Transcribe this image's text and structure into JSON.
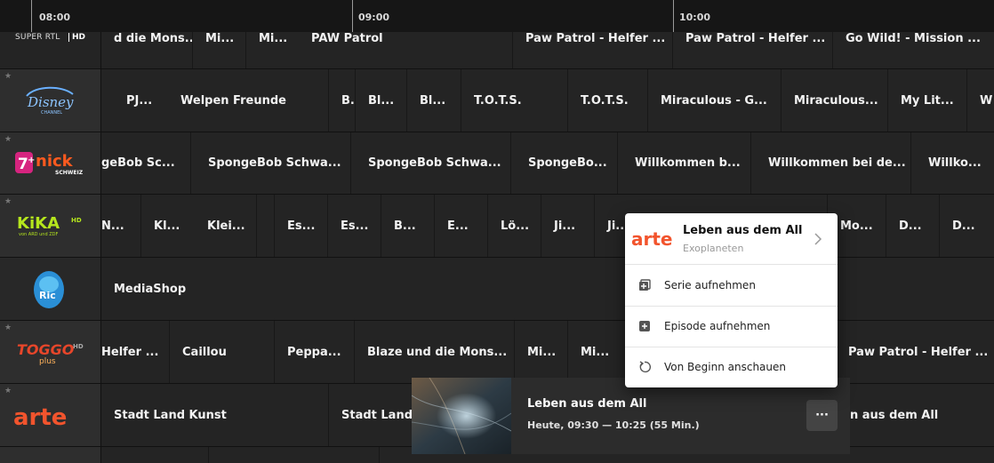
{
  "timeline": {
    "times": [
      "08:00",
      "09:00",
      "10:00"
    ]
  },
  "channels": [
    {
      "name": "SUPER RTL",
      "hd": "HD",
      "programs": [
        "d die Mons...",
        "Mi...",
        "Mi...",
        "PAW Patrol",
        "Paw Patrol - Helfer ...",
        "Paw Patrol - Helfer ...",
        "Go Wild! - Mission ..."
      ]
    },
    {
      "name": "Disney Channel",
      "programs": [
        "PJ...",
        "Welpen Freunde",
        "B.",
        "Bl...",
        "Bl...",
        "T.O.T.S.",
        "T.O.T.S.",
        "Miraculous - G...",
        "Miraculous...",
        "My Lit...",
        "W"
      ]
    },
    {
      "name": "Nick Schweiz",
      "programs": [
        "geBob Sc...",
        "SpongeBob Schwa...",
        "SpongeBob Schwa...",
        "SpongeBo...",
        "Willkommen b...",
        "Willkommen bei de...",
        "Willko..."
      ]
    },
    {
      "name": "KiKA",
      "hd": "HD",
      "programs": [
        "N...",
        "Kl...",
        "Klei...",
        "Es...",
        "Es...",
        "B...",
        "E...",
        "Lö...",
        "Ji...",
        "Ji...",
        "Mo...",
        "D...",
        "D..."
      ]
    },
    {
      "name": "Ric",
      "programs": [
        "MediaShop"
      ]
    },
    {
      "name": "Toggo plus",
      "hd": "HD",
      "programs": [
        "Helfer ...",
        "Caillou",
        "Peppa...",
        "Blaze und die Mons...",
        "Mi...",
        "Mi...",
        "Paw Patrol - Helfer ..."
      ]
    },
    {
      "name": "arte",
      "programs": [
        "Stadt Land Kunst",
        "Stadt Land",
        "n aus dem All"
      ]
    }
  ],
  "popup": {
    "channel_logo": "arte",
    "title": "Leben aus dem All",
    "subtitle": "Exoplaneten",
    "items": [
      {
        "icon": "record-series-icon",
        "label": "Serie aufnehmen"
      },
      {
        "icon": "record-episode-icon",
        "label": "Episode aufnehmen"
      },
      {
        "icon": "restart-icon",
        "label": "Von Beginn anschauen"
      }
    ]
  },
  "mini_player": {
    "title": "Leben aus dem All",
    "time": "Heute, 09:30 — 10:25 (55 Min.)",
    "more_label": "···"
  }
}
